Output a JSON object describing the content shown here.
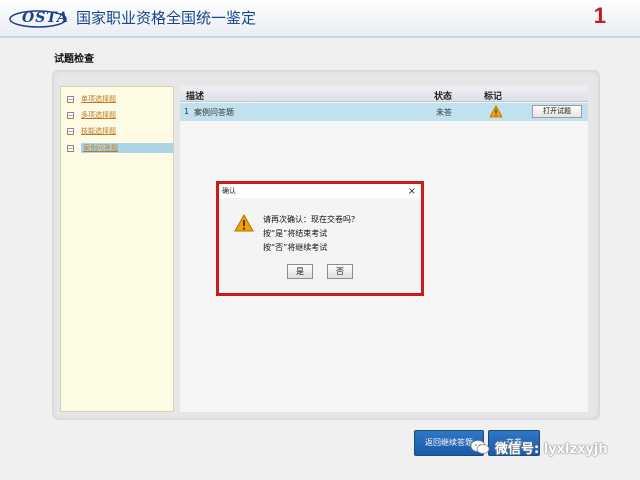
{
  "header": {
    "logo_text": "OSTA",
    "title": "国家职业资格全国统一鉴定",
    "number": "1"
  },
  "section_title": "试题检查",
  "question_types": [
    {
      "toggle": "⊟",
      "label": "单项选择题"
    },
    {
      "toggle": "⊟",
      "label": "多项选择题"
    },
    {
      "toggle": "⊟",
      "label": "技能选择题"
    },
    {
      "toggle": "⊟",
      "label": "案例问答题",
      "active": true
    }
  ],
  "table": {
    "columns": [
      "描述",
      "状态",
      "标记"
    ],
    "rows": [
      {
        "index": "1",
        "description": "案例问答题",
        "status": "未答",
        "action": "打开试题"
      }
    ]
  },
  "dialog": {
    "title": "确认",
    "close": "×",
    "lines": [
      "请再次确认：现在交卷吗？",
      "按“是”将结束考试",
      "按“否”将继续考试"
    ],
    "yes": "是",
    "no": "否"
  },
  "bottom_buttons": {
    "back": "返回继续答题",
    "submit": "交卷"
  },
  "watermark": {
    "text": "微信号: lyxlzxyjh"
  },
  "colors": {
    "dialog_border": "#cc1b1b",
    "header_number": "#c8171d",
    "row_highlight": "#bfe2ee",
    "warning": "#f0a400"
  }
}
